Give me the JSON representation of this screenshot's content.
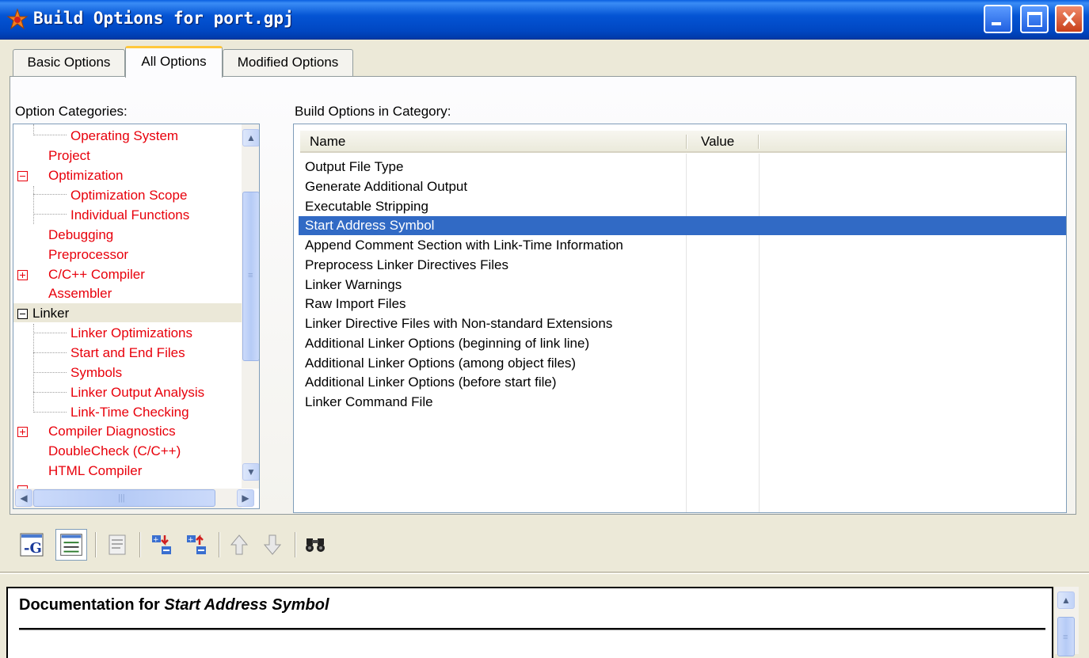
{
  "window": {
    "title": "Build Options for port.gpj",
    "icon": "build-options-app-icon"
  },
  "tabs": [
    {
      "label": "Basic Options",
      "active": false
    },
    {
      "label": "All Options",
      "active": true
    },
    {
      "label": "Modified Options",
      "active": false
    }
  ],
  "categories_panel": {
    "label": "Option Categories:",
    "items": [
      {
        "label": "Operating System",
        "depth": 2,
        "color": "red"
      },
      {
        "label": "Project",
        "depth": 1,
        "color": "red"
      },
      {
        "label": "Optimization",
        "depth": 1,
        "color": "red",
        "expander": "minus"
      },
      {
        "label": "Optimization Scope",
        "depth": 2,
        "color": "red"
      },
      {
        "label": "Individual Functions",
        "depth": 2,
        "color": "red"
      },
      {
        "label": "Debugging",
        "depth": 1,
        "color": "red"
      },
      {
        "label": "Preprocessor",
        "depth": 1,
        "color": "red"
      },
      {
        "label": "C/C++ Compiler",
        "depth": 1,
        "color": "red",
        "expander": "plus"
      },
      {
        "label": "Assembler",
        "depth": 1,
        "color": "red"
      },
      {
        "label": "Linker",
        "depth": 1,
        "color": "black",
        "expander": "minus",
        "selected": true
      },
      {
        "label": "Linker Optimizations",
        "depth": 2,
        "color": "red"
      },
      {
        "label": "Start and End Files",
        "depth": 2,
        "color": "red"
      },
      {
        "label": "Symbols",
        "depth": 2,
        "color": "red"
      },
      {
        "label": "Linker Output Analysis",
        "depth": 2,
        "color": "red"
      },
      {
        "label": "Link-Time Checking",
        "depth": 2,
        "color": "red"
      },
      {
        "label": "Compiler Diagnostics",
        "depth": 1,
        "color": "red",
        "expander": "plus"
      },
      {
        "label": "DoubleCheck (C/C++)",
        "depth": 1,
        "color": "red"
      },
      {
        "label": "HTML Compiler",
        "depth": 1,
        "color": "red"
      }
    ]
  },
  "options_panel": {
    "label": "Build Options in Category:",
    "columns": [
      "Name",
      "Value"
    ],
    "rows": [
      {
        "name": "Output File Type",
        "value": ""
      },
      {
        "name": "Generate Additional Output",
        "value": ""
      },
      {
        "name": "Executable Stripping",
        "value": ""
      },
      {
        "name": "Start Address Symbol",
        "value": "",
        "selected": true
      },
      {
        "name": "Append Comment Section with Link-Time Information",
        "value": ""
      },
      {
        "name": "Preprocess Linker Directives Files",
        "value": ""
      },
      {
        "name": "Linker Warnings",
        "value": ""
      },
      {
        "name": "Raw Import Files",
        "value": ""
      },
      {
        "name": "Linker Directive Files with Non-standard Extensions",
        "value": ""
      },
      {
        "name": "Additional Linker Options (beginning of link line)",
        "value": ""
      },
      {
        "name": "Additional Linker Options (among object files)",
        "value": ""
      },
      {
        "name": "Additional Linker Options (before start file)",
        "value": ""
      },
      {
        "name": "Linker Command File",
        "value": ""
      }
    ]
  },
  "toolbar": {
    "buttons": [
      {
        "icon": "show-command-line-icon",
        "pressed": false
      },
      {
        "icon": "show-option-names-icon",
        "pressed": true
      },
      {
        "icon": "edit-option-icon",
        "pressed": false
      },
      {
        "icon": "add-option-icon",
        "pressed": false
      },
      {
        "icon": "remove-option-icon",
        "pressed": false
      },
      {
        "icon": "move-up-icon",
        "pressed": false
      },
      {
        "icon": "move-down-icon",
        "pressed": false
      },
      {
        "icon": "find-binoculars-icon",
        "pressed": false
      }
    ]
  },
  "documentation": {
    "prefix": "Documentation for ",
    "subject": "Start Address Symbol"
  }
}
